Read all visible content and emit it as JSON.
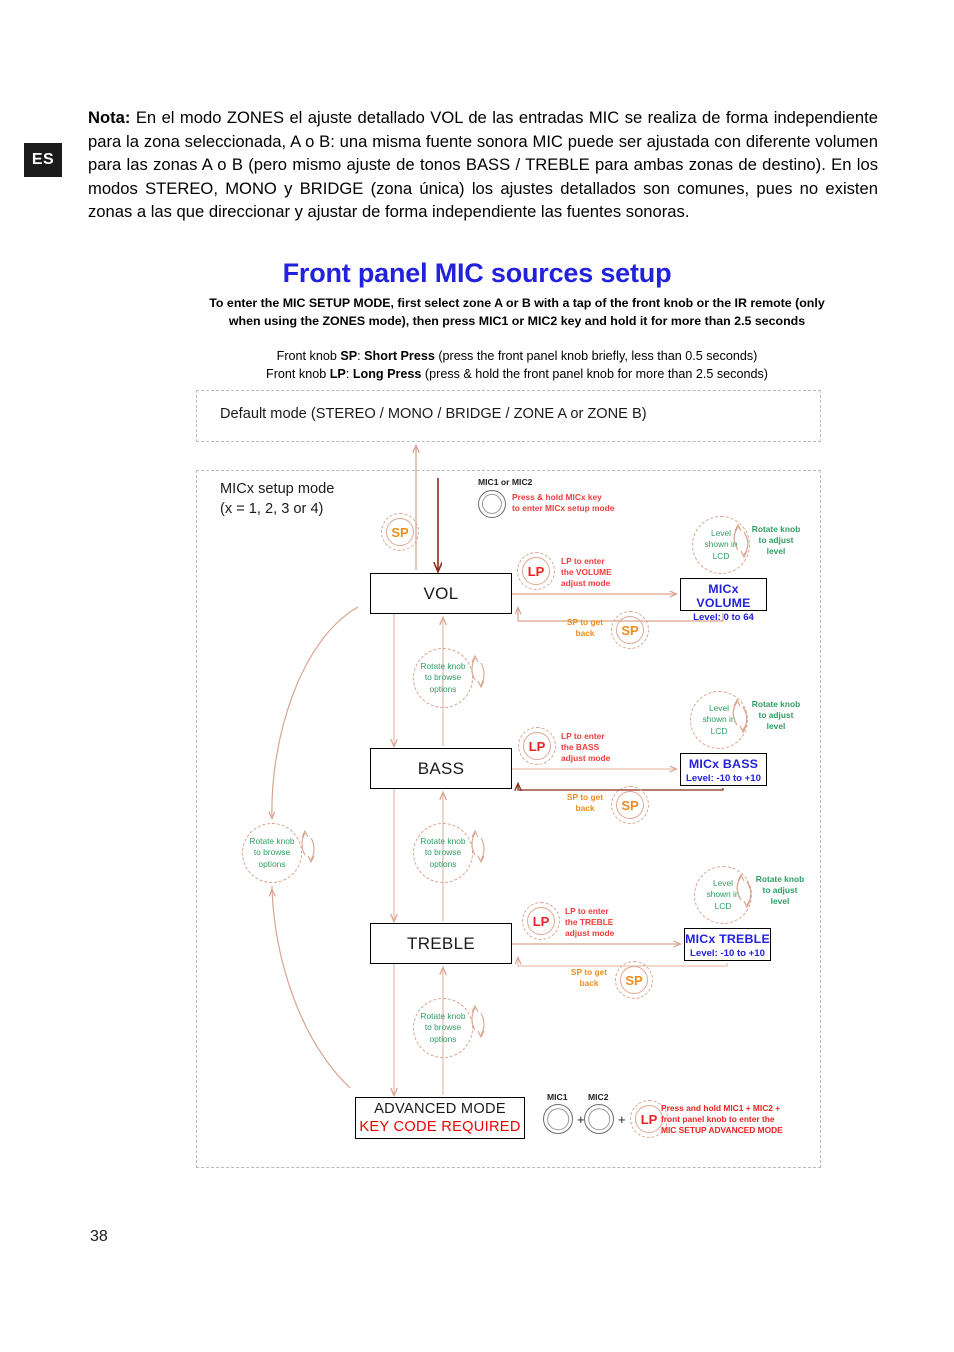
{
  "language_badge": "ES",
  "page_number": "38",
  "nota": {
    "label": "Nota:",
    "body": "En el modo ZONES el ajuste detallado VOL de las entradas MIC se realiza de forma independiente para la zona seleccionada, A o B: una misma fuente sonora MIC puede ser ajustada con diferente volumen para las zonas A o B (pero mismo ajuste de tonos BASS / TREBLE para ambas zonas de destino). En los modos STEREO, MONO y BRIDGE (zona única) los ajustes detallados son comunes, pues no existen zonas a las que direccionar y ajustar de forma independiente las fuentes sonoras."
  },
  "heading": {
    "title": "Front panel MIC sources setup",
    "subtitle": "To enter the MIC SETUP MODE, first select zone A or B with a tap of the front knob or the IR remote (only when using the  ZONES mode), then press MIC1 or MIC2 key and hold it for more than 2.5 seconds",
    "legend_sp_prefix": "Front knob  ",
    "legend_sp_key": "SP",
    "legend_sp_mid": ": ",
    "legend_sp_name": "Short Press",
    "legend_sp_desc": "  (press the front panel knob briefly, less than 0.5 seconds)",
    "legend_lp_prefix": "Front knob  ",
    "legend_lp_key": "LP",
    "legend_lp_mid": ": ",
    "legend_lp_name": "Long Press",
    "legend_lp_desc": "  (press & hold the front panel knob for more than 2.5 seconds)"
  },
  "containers": {
    "default_mode_label": "Default mode (STEREO / MONO / BRIDGE / ZONE A or ZONE B)",
    "setup_mode_label": "MICx setup mode\n(x = 1, 2, 3 or 4)"
  },
  "entry": {
    "knob_label": "MIC1 or MIC2",
    "note": "Press & hold MICx key\nto enter MICx setup mode"
  },
  "nodes": {
    "vol": "VOL",
    "bass": "BASS",
    "treble": "TREBLE",
    "advanced_line1": "ADVANCED MODE",
    "advanced_line2": "KEY CODE REQUIRED"
  },
  "lcd": [
    {
      "name": "MICx VOLUME",
      "range": "Level: 0 to 64"
    },
    {
      "name": "MICx BASS",
      "range": "Level: -10 to +10"
    },
    {
      "name": "MICx TREBLE",
      "range": "Level: -10 to +10"
    }
  ],
  "tokens": {
    "sp": "SP",
    "lp": "LP"
  },
  "captions": {
    "lp_volume": "LP to enter\nthe VOLUME\nadjust mode",
    "lp_bass": "LP to enter\nthe BASS\nadjust mode",
    "lp_treble": "LP to enter\nthe TREBLE\nadjust mode",
    "sp_back": "SP to get\nback",
    "rotate_browse": "Rotate knob\nto browse\noptions",
    "rotate_adjust": "Rotate knob\nto adjust\nlevel",
    "level_lcd": "Level\nshown in\nLCD",
    "advanced_note": "Press and hold MIC1 + MIC2 +\nfront panel knob to enter the\nMIC SETUP ADVANCED MODE"
  },
  "advanced_keys": {
    "mic1": "MIC1",
    "mic2": "MIC2",
    "plus": "+"
  },
  "colors": {
    "title": "#2222dd",
    "lcd_text": "#2222dd",
    "red": "#ee2222",
    "orange": "#f08c1e",
    "green": "#2e9e63",
    "wire": "#d9a48e",
    "wire_dark": "#8b2a18"
  }
}
